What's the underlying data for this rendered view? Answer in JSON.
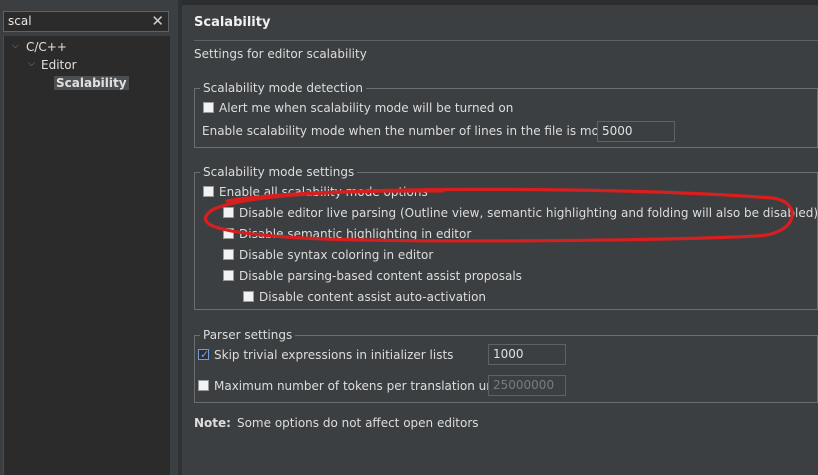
{
  "search": {
    "value": "scal"
  },
  "tree": {
    "items": [
      {
        "label": "C/C++"
      },
      {
        "label": "Editor"
      },
      {
        "label": "Scalability"
      }
    ]
  },
  "page": {
    "title": "Scalability",
    "subtitle": "Settings for editor scalability",
    "note_label": "Note:",
    "note_text": "Some options do not affect open editors"
  },
  "detection": {
    "legend": "Scalability mode detection",
    "alert_label": "Alert me when scalability mode will be turned on",
    "alert_checked": false,
    "lines_label": "Enable scalability mode when the number of lines in the file is more than:",
    "lines_value": "5000"
  },
  "settings": {
    "legend": "Scalability mode settings",
    "options": [
      {
        "label": "Enable all scalability mode options",
        "checked": false
      },
      {
        "label": "Disable editor live parsing (Outline view, semantic highlighting and folding will also be disabled)",
        "checked": false
      },
      {
        "label": "Disable semantic highlighting in editor",
        "checked": false
      },
      {
        "label": "Disable syntax coloring in editor",
        "checked": false
      },
      {
        "label": "Disable parsing-based content assist proposals",
        "checked": false
      },
      {
        "label": "Disable content assist auto-activation",
        "checked": false
      }
    ]
  },
  "parser": {
    "legend": "Parser settings",
    "skip_label": "Skip trivial expressions in initializer lists",
    "skip_checked": true,
    "skip_value": "1000",
    "max_label": "Maximum number of tokens per translation unit:",
    "max_checked": false,
    "max_value": "25000000"
  },
  "colors": {
    "annotation": "#d81e1e",
    "checkmark": "#6aa4e8"
  }
}
